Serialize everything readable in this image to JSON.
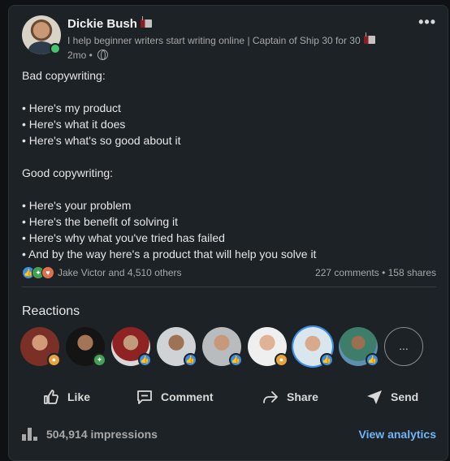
{
  "post": {
    "author": {
      "name": "Dickie Bush",
      "headline": "I help beginner writers start writing online | Captain of Ship 30 for 30",
      "time": "2mo •"
    },
    "more_label": "•••",
    "body_lines": [
      "Bad copywriting:",
      "",
      "• Here's my product",
      "• Here's what it does",
      "• Here's what's so good about it",
      "",
      "Good copywriting:",
      "",
      "• Here's your problem",
      "• Here's the benefit of solving it",
      "• Here's why what you've tried has failed",
      "• And by the way here's a product that will help you solve it"
    ],
    "social": {
      "reactions_text": "Jake Victor and 4,510 others",
      "counts_text": "227 comments • 158 shares"
    }
  },
  "reactions": {
    "title": "Reactions",
    "more_label": "...",
    "people": [
      {
        "reaction": "insight"
      },
      {
        "reaction": "celebrate"
      },
      {
        "reaction": "like"
      },
      {
        "reaction": "like"
      },
      {
        "reaction": "like"
      },
      {
        "reaction": "insight"
      },
      {
        "reaction": "like"
      },
      {
        "reaction": "like"
      }
    ]
  },
  "actions": {
    "like": "Like",
    "comment": "Comment",
    "share": "Share",
    "send": "Send"
  },
  "footer": {
    "impressions": "504,914 impressions",
    "view_analytics": "View analytics"
  },
  "colors": {
    "card_bg": "#1d2226",
    "link": "#70b5f9",
    "like": "#378fe9",
    "celebrate": "#44a153",
    "insight": "#e7a33e",
    "love": "#df704d"
  }
}
